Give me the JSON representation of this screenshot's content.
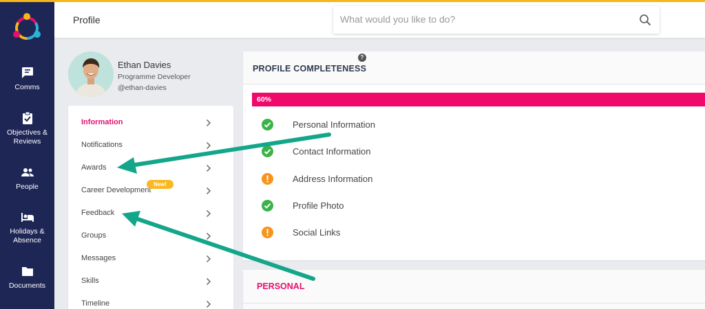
{
  "header": {
    "title": "Profile",
    "search_placeholder": "What would you like to do?"
  },
  "colors": {
    "nav_bg": "#1e2656",
    "accent_line": "#f5b51b",
    "brand_pink": "#e3106c",
    "progress_fill": "#f0086a",
    "success": "#3cb34a",
    "warning": "#f7941d",
    "badge": "#f8b821",
    "annotation_arrow": "#14a68a"
  },
  "nav": {
    "items": [
      {
        "label": "Comms",
        "icon": "chat-icon"
      },
      {
        "label": "Objectives & Reviews",
        "icon": "clipboard-check-icon"
      },
      {
        "label": "People",
        "icon": "people-icon"
      },
      {
        "label": "Holidays & Absence",
        "icon": "bed-icon"
      },
      {
        "label": "Documents",
        "icon": "folder-icon"
      }
    ]
  },
  "user": {
    "name": "Ethan Davies",
    "role": "Programme Developer",
    "handle": "@ethan-davies"
  },
  "menu": {
    "items": [
      {
        "label": "Information",
        "active": true
      },
      {
        "label": "Notifications"
      },
      {
        "label": "Awards"
      },
      {
        "label": "Career Development"
      },
      {
        "label": "Feedback"
      },
      {
        "label": "Groups"
      },
      {
        "label": "Messages"
      },
      {
        "label": "Skills"
      },
      {
        "label": "Timeline"
      }
    ],
    "new_badge": "New!"
  },
  "completeness": {
    "title": "PROFILE COMPLETENESS",
    "help": "?",
    "progress_percent": 60,
    "progress_label": "60%",
    "items": [
      {
        "label": "Personal Information",
        "status": "complete"
      },
      {
        "label": "Contact Information",
        "status": "complete"
      },
      {
        "label": "Address Information",
        "status": "incomplete"
      },
      {
        "label": "Profile Photo",
        "status": "complete"
      },
      {
        "label": "Social Links",
        "status": "incomplete"
      }
    ]
  },
  "personal": {
    "title": "PERSONAL"
  }
}
